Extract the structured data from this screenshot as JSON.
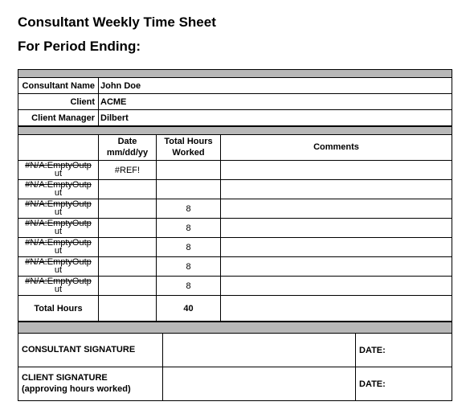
{
  "title": "Consultant Weekly Time Sheet",
  "period_label": "For Period Ending:",
  "info": {
    "consultant_label": "Consultant Name",
    "consultant_value": "John Doe",
    "client_label": "Client",
    "client_value": "ACME",
    "manager_label": "Client Manager",
    "manager_value": "Dilbert"
  },
  "headers": {
    "date": "Date mm/dd/yy",
    "hours": "Total Hours Worked",
    "comments": "Comments"
  },
  "day_error_top": "#N/A:EmptyOutp",
  "day_error_bot": "ut",
  "rows": [
    {
      "date": "#REF!",
      "hours": "",
      "comments": ""
    },
    {
      "date": "",
      "hours": "",
      "comments": ""
    },
    {
      "date": "",
      "hours": "8",
      "comments": ""
    },
    {
      "date": "",
      "hours": "8",
      "comments": ""
    },
    {
      "date": "",
      "hours": "8",
      "comments": ""
    },
    {
      "date": "",
      "hours": "8",
      "comments": ""
    },
    {
      "date": "",
      "hours": "8",
      "comments": ""
    }
  ],
  "total_label": "Total Hours",
  "total_value": "40",
  "signatures": {
    "consultant_label": "CONSULTANT SIGNATURE",
    "client_label_line1": "CLIENT SIGNATURE",
    "client_label_line2": "(approving hours worked)",
    "date_label": "DATE:"
  }
}
